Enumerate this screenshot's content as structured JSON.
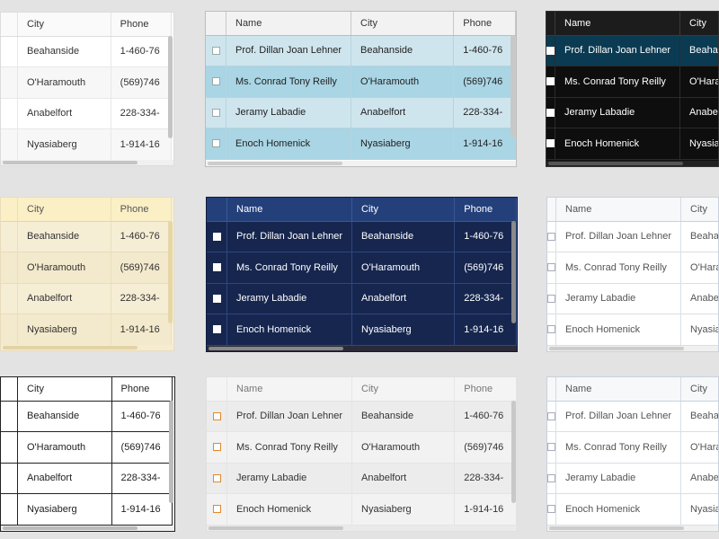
{
  "headers": {
    "name": "Name",
    "city": "City",
    "phone": "Phone"
  },
  "rows": [
    {
      "name": "Prof. Dillan Joan Lehner",
      "city": "Beahanside",
      "phone": "1-460-76"
    },
    {
      "name": "Ms. Conrad Tony Reilly",
      "city": "O'Haramouth",
      "phone": "(569)746"
    },
    {
      "name": "Jeramy Labadie",
      "city": "Anabelfort",
      "phone": "228-334-"
    },
    {
      "name": "Enoch Homenick",
      "city": "Nyasiaberg",
      "phone": "1-914-16"
    }
  ],
  "colors": {
    "aqua_row_odd": "#cfe5ee",
    "aqua_row_even": "#a9d5e4",
    "black_selected_row": "#0b3b52",
    "navy_header": "#24407b",
    "navy_body": "#16264f",
    "cream_header": "#fbefc6",
    "soft_checkbox_border": "#e08a2a"
  },
  "icons": {
    "checkbox": "checkbox-icon"
  }
}
